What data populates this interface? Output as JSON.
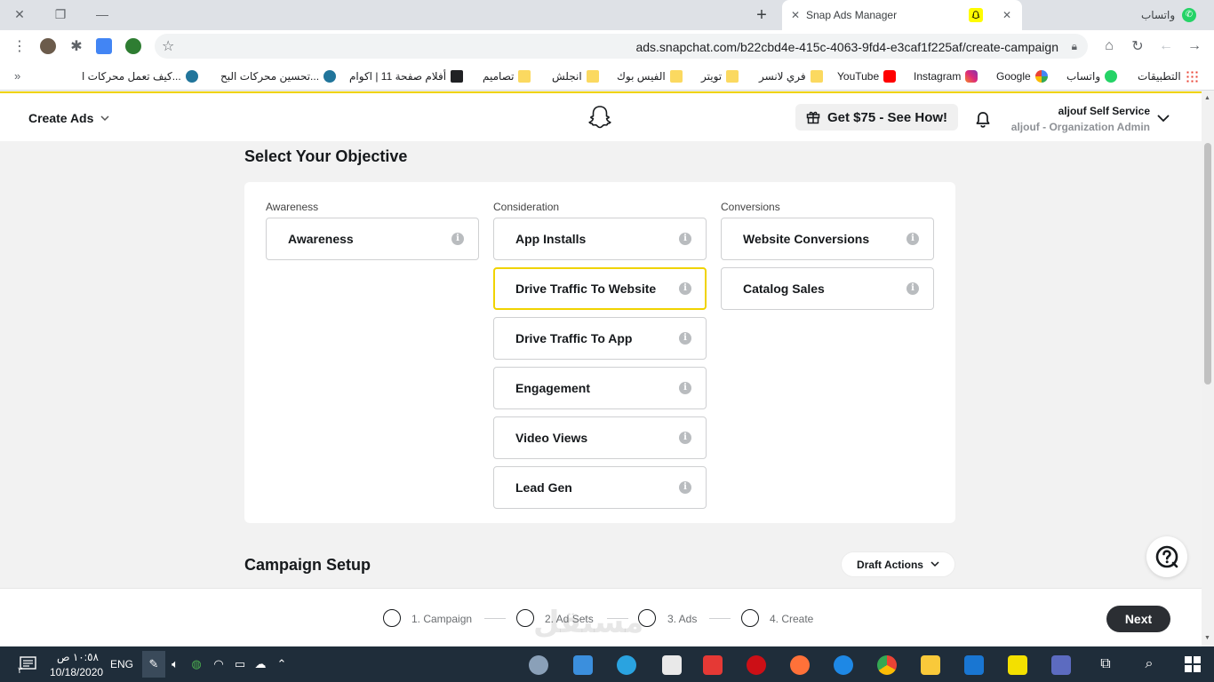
{
  "browser": {
    "active_tab_title": "Snap Ads Manager",
    "other_tab_title": "واتساب",
    "url": "ads.snapchat.com/b22cbd4e-415c-4063-9fd4-e3caf1f225af/create-campaign",
    "bookmarks": [
      {
        "label": "التطبيقات",
        "icon": "apps-icon"
      },
      {
        "label": "واتساب",
        "icon": "whatsapp-icon"
      },
      {
        "label": "Google",
        "icon": "google-icon"
      },
      {
        "label": "Instagram",
        "icon": "instagram-icon"
      },
      {
        "label": "YouTube",
        "icon": "youtube-icon"
      },
      {
        "label": "فري لانسر",
        "icon": "folder-icon"
      },
      {
        "label": "تويتر",
        "icon": "folder-icon"
      },
      {
        "label": "الفيس بوك",
        "icon": "folder-icon"
      },
      {
        "label": "انجلش",
        "icon": "folder-icon"
      },
      {
        "label": "تصاميم",
        "icon": "folder-icon"
      },
      {
        "label": "أفلام صفحة 11 | اكوام",
        "icon": "triangle-icon"
      },
      {
        "label": "تحسين محركات البح...",
        "icon": "wordpress-icon"
      },
      {
        "label": "كيف تعمل محركات ا...",
        "icon": "wordpress-icon"
      }
    ],
    "more_bookmarks": "»"
  },
  "header": {
    "create_ads": "Create Ads",
    "promo": "Get $75 - See How!",
    "account_name": "aljouf Self Service",
    "account_role": "aljouf - Organization Admin"
  },
  "objective": {
    "title": "Select Your Objective",
    "columns": [
      {
        "label": "Awareness",
        "options": [
          "Awareness"
        ]
      },
      {
        "label": "Consideration",
        "options": [
          "App Installs",
          "Drive Traffic To Website",
          "Drive Traffic To App",
          "Engagement",
          "Video Views",
          "Lead Gen"
        ]
      },
      {
        "label": "Conversions",
        "options": [
          "Website Conversions",
          "Catalog Sales"
        ]
      }
    ],
    "selected": "Drive Traffic To Website",
    "info_glyph": "i"
  },
  "campaign_setup": {
    "title": "Campaign Setup",
    "draft_actions": "Draft Actions"
  },
  "stepper": {
    "steps": [
      "1. Campaign",
      "2. Ad Sets",
      "3. Ads",
      "4. Create"
    ],
    "next": "Next"
  },
  "watermark": "مستقل",
  "taskbar": {
    "time": "١٠:٥٨ ص",
    "date": "10/18/2020",
    "lang": "ENG",
    "notification_count": "٣"
  },
  "colors": {
    "snap_yellow": "#f0d300",
    "next_button": "#2b2e33",
    "taskbar": "#1f2d3a"
  }
}
